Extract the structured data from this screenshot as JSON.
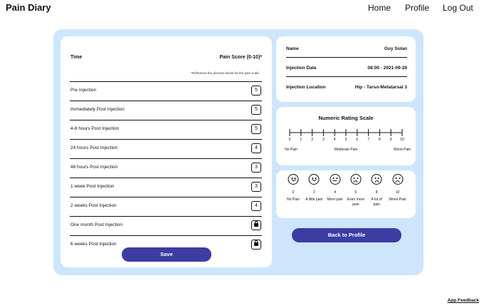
{
  "app": {
    "title": "Pain Diary"
  },
  "nav": {
    "home": "Home",
    "profile": "Profile",
    "logout": "Log Out"
  },
  "diary": {
    "col_time": "Time",
    "col_score": "Pain Score (0-10)*",
    "note": "*Reference the pictures below for the pain scale.",
    "rows": [
      {
        "label": "Pre Injection",
        "score": "5",
        "locked": false
      },
      {
        "label": "Immediately Post Injection",
        "score": "5",
        "locked": false
      },
      {
        "label": "4-8 hours Post Injection",
        "score": "5",
        "locked": false
      },
      {
        "label": "24 hours Post Injection",
        "score": "4",
        "locked": false
      },
      {
        "label": "48 hours Post Injection",
        "score": "3",
        "locked": false
      },
      {
        "label": "1 week Post Injection",
        "score": "3",
        "locked": false
      },
      {
        "label": "2 weeks Post Injection",
        "score": "4",
        "locked": false
      },
      {
        "label": "One month Post Injection",
        "score": "",
        "locked": true
      },
      {
        "label": "6 weeks Post Injection",
        "score": "",
        "locked": true
      }
    ],
    "save_label": "Save"
  },
  "info": {
    "name_label": "Name",
    "name_value": "Guy Solan",
    "date_label": "Injection Date",
    "date_value": "08:00 - 2021-09-28",
    "loc_label": "Injection Location",
    "loc_value": "Hip - Tarso-Metatarsal 3"
  },
  "scale": {
    "title": "Numeric Rating Scale",
    "ticks": [
      "0",
      "1",
      "2",
      "3",
      "4",
      "5",
      "6",
      "7",
      "8",
      "9",
      "10"
    ],
    "labels": {
      "low": "No Pain",
      "mid": "Moderate Pain",
      "high": "Worst Pain"
    }
  },
  "faces": [
    {
      "value": "0",
      "label": "No Pain",
      "icon": "grin-face-icon"
    },
    {
      "value": "2",
      "label": "A little pain",
      "icon": "smile-face-icon"
    },
    {
      "value": "4",
      "label": "More pain",
      "icon": "neutral-face-icon"
    },
    {
      "value": "6",
      "label": "Even more pain",
      "icon": "frown-face-icon"
    },
    {
      "value": "8",
      "label": "A lot of pain",
      "icon": "sad-face-icon"
    },
    {
      "value": "10",
      "label": "Worst Pain",
      "icon": "crying-face-icon"
    }
  ],
  "actions": {
    "back_label": "Back to Profile",
    "feedback_label": "App Feedback"
  },
  "colors": {
    "panel": "#cde6fb",
    "button": "#3d3ca3"
  }
}
